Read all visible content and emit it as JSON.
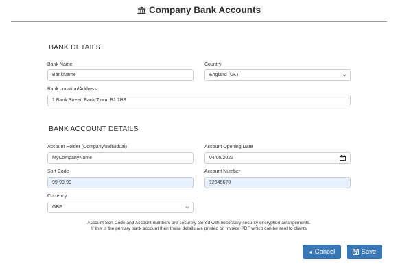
{
  "header": {
    "title": "Company Bank Accounts",
    "icon": "bank-icon"
  },
  "bank_details": {
    "heading": "BANK DETAILS",
    "bank_name": {
      "label": "Bank Name",
      "value": "BankName"
    },
    "country": {
      "label": "Country",
      "value": "England (UK)"
    },
    "location": {
      "label": "Bank Location/Address",
      "value": "1 Bank Street, Bank Town, B1 1BB"
    }
  },
  "account_details": {
    "heading": "BANK ACCOUNT DETAILS",
    "holder": {
      "label": "Account Holder (Company/Individual)",
      "value": "MyCompanyName"
    },
    "opening_date": {
      "label": "Account Opening Date",
      "value": "04/05/2022"
    },
    "sort_code": {
      "label": "Sort Code",
      "value": "99-99-99"
    },
    "account_number": {
      "label": "Account Number",
      "value": "12345678"
    },
    "currency": {
      "label": "Currency",
      "value": "GBP"
    }
  },
  "note": {
    "line1": "Account Sort Code and Account numbers are securely stored with necessary security encryption arrangements.",
    "line2": "If this is the primary bank account then these details are printed on invoice PDF which can be sent to clients"
  },
  "buttons": {
    "cancel": "Cancel",
    "save": "Save"
  },
  "colors": {
    "primary": "#3a78b5",
    "autofill": "#e8f0fe",
    "border": "#c9ced6"
  }
}
